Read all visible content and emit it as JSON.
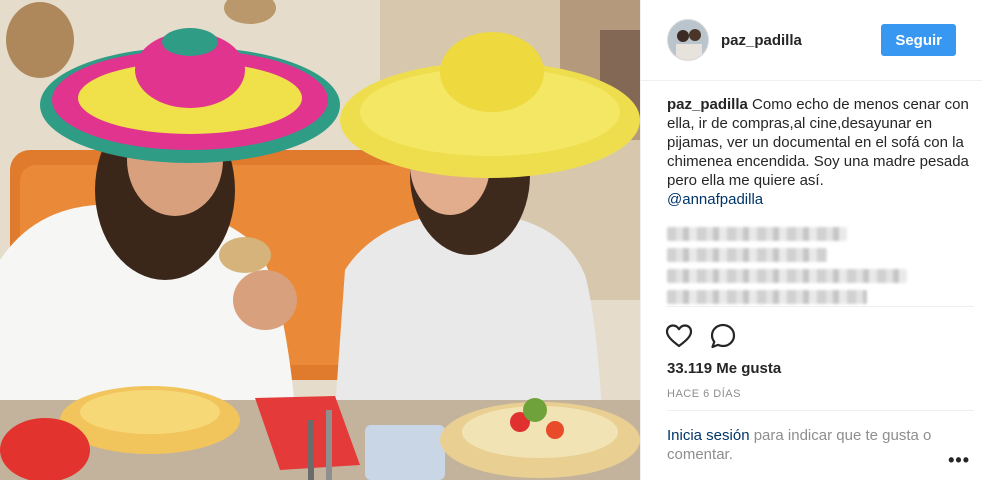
{
  "header": {
    "username": "paz_padilla",
    "follow_label": "Seguir"
  },
  "caption": {
    "username": "paz_padilla",
    "text": "Como echo de menos cenar con ella, ir de compras,al cine,desayunar en pijamas, ver un documental en el sofá con la chimenea encendida. Soy una madre pesada pero ella me quiere así.",
    "mention": "@annafpadilla"
  },
  "stats": {
    "likes": "33.119 Me gusta",
    "timestamp": "HACE 6 DÍAS"
  },
  "login": {
    "link_text": "Inicia sesión",
    "rest_text": "para indicar que te gusta o comentar."
  },
  "more_label": "•••",
  "icons": {
    "like": "heart-icon",
    "comment": "comment-icon",
    "options": "more-options-icon"
  },
  "colors": {
    "follow_button": "#3897f0",
    "link": "#003569",
    "muted": "#8e8e8e"
  }
}
